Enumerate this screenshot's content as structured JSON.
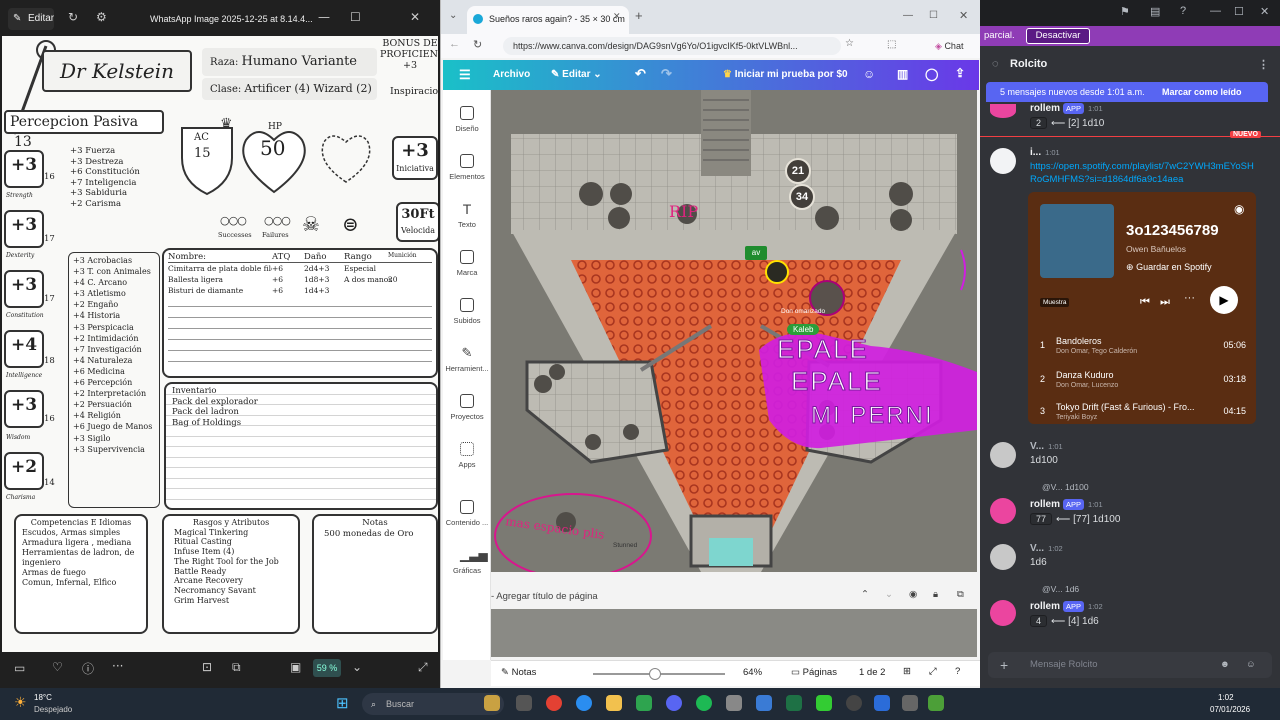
{
  "viewer": {
    "edit_label": "Editar",
    "title": "WhatsApp Image 2025-12-25 at 8.14.4...",
    "zoom": "59 %"
  },
  "sheet": {
    "name": "Dr Kelstein",
    "raza_label": "Raza:",
    "raza": "Humano Variante",
    "clase_label": "Clase:",
    "clase": "Artificer (4) Wizard (2)",
    "bonus": "BONUS DE PROFICIENCY",
    "bonus_val": "+3",
    "inspiracion": "Inspiracion",
    "percepcion": "Percepcion Pasiva",
    "percepcion_val": "13",
    "ac_label": "AC",
    "ac": "15",
    "hp_label": "HP",
    "hp": "50",
    "iniciativa": "Iniciativa",
    "iniciativa_val": "+3",
    "velocidad": "Velocida",
    "velocidad_val": "30Ft",
    "successes": "Successes",
    "failures": "Failures",
    "abilities": [
      {
        "mod": "+3",
        "score": "16",
        "name": "Strength"
      },
      {
        "mod": "+3",
        "score": "17",
        "name": "Dexterity"
      },
      {
        "mod": "+3",
        "score": "17",
        "name": "Constitution"
      },
      {
        "mod": "+4",
        "score": "18",
        "name": "Intelligence"
      },
      {
        "mod": "+3",
        "score": "16",
        "name": "Wisdom"
      },
      {
        "mod": "+2",
        "score": "14",
        "name": "Charisma"
      }
    ],
    "saves": [
      {
        "v": "+3",
        "n": "Fuerza"
      },
      {
        "v": "+3",
        "n": "Destreza"
      },
      {
        "v": "+6",
        "n": "Constitución"
      },
      {
        "v": "+7",
        "n": "Inteligencia"
      },
      {
        "v": "+3",
        "n": "Sabiduria"
      },
      {
        "v": "+2",
        "n": "Carisma"
      }
    ],
    "skills": [
      {
        "v": "+3",
        "n": "Acrobacias"
      },
      {
        "v": "+3",
        "n": "T. con Animales"
      },
      {
        "v": "+4",
        "n": "C. Arcano"
      },
      {
        "v": "+3",
        "n": "Atletismo"
      },
      {
        "v": "+2",
        "n": "Engaño"
      },
      {
        "v": "+4",
        "n": "Historia"
      },
      {
        "v": "+3",
        "n": "Perspicacia"
      },
      {
        "v": "+2",
        "n": "Intimidación"
      },
      {
        "v": "+7",
        "n": "Investigación"
      },
      {
        "v": "+4",
        "n": "Naturaleza"
      },
      {
        "v": "+6",
        "n": "Medicina"
      },
      {
        "v": "+6",
        "n": "Percepción"
      },
      {
        "v": "+2",
        "n": "Interpretación"
      },
      {
        "v": "+2",
        "n": "Persuación"
      },
      {
        "v": "+4",
        "n": "Religión"
      },
      {
        "v": "+6",
        "n": "Juego de Manos"
      },
      {
        "v": "+3",
        "n": "Sigilo"
      },
      {
        "v": "+3",
        "n": "Supervivencia"
      }
    ],
    "attack_headers": [
      "Nombre:",
      "ATQ",
      "Daño",
      "Rango",
      "Munición"
    ],
    "attacks": [
      {
        "n": "Cimitarra de plata doble filo",
        "a": "+6",
        "d": "2d4+3",
        "r": "Especial",
        "m": ""
      },
      {
        "n": "Ballesta ligera",
        "a": "+6",
        "d": "1d8+3",
        "r": "A dos manos",
        "m": "20"
      },
      {
        "n": "Bisturi de diamante",
        "a": "+6",
        "d": "1d4+3",
        "r": "",
        "m": ""
      }
    ],
    "inventario_title": "Inventario",
    "inventario": [
      "Pack del explorador",
      "Pack del ladron",
      "Bag of Holdings"
    ],
    "competencias_title": "Competencias E Idiomas",
    "competencias": [
      "Escudos, Armas simples",
      "Armadura ligera , mediana",
      "Herramientas de ladron, de ingeniero",
      "Armas de fuego",
      "Comun, Infernal, Elfico"
    ],
    "rasgos_title": "Rasgos y Atributos",
    "rasgos": [
      "Magical Tinkering",
      "Ritual Casting",
      "Infuse Item (4)",
      "The Right Tool for the Job",
      "Battle Ready",
      "Arcane Recovery",
      "Necromancy Savant",
      "Grim Harvest"
    ],
    "notas_title": "Notas",
    "notas": [
      "500 monedas de Oro"
    ]
  },
  "browser": {
    "tab_title": "Sueños raros again? - 35 × 30 cm",
    "url": "https://www.canva.com/design/DAG9snVg6Yo/O1igvcIKf5-0ktVLWBnl...",
    "chat": "Chat",
    "canva": {
      "archivo": "Archivo",
      "editar": "Editar",
      "trial": "Iniciar mi prueba por $0",
      "side": [
        "Diseño",
        "Elementos",
        "Texto",
        "Marca",
        "Subidos",
        "Herramient...",
        "Proyectos",
        "Apps",
        "Contenido ...",
        "Gráficas"
      ],
      "page_title_placeholder": "- Agregar título de página",
      "notas": "Notas",
      "zoom": "64%",
      "paginas": "Páginas",
      "page_count": "1 de 2"
    },
    "map": {
      "token_21": "21",
      "token_34": "34",
      "av": "av",
      "don_label": "Don omarizado",
      "kaleb": "Kaleb",
      "rip": "RIP",
      "scribble_1": "EPALE",
      "scribble_2": "EPALE",
      "scribble_3": "MI PERNI",
      "pink_note": "mas espacio plis",
      "stunned": "Stunned"
    }
  },
  "discord": {
    "banner_text": "parcial.",
    "banner_button": "Desactivar",
    "channel": "Rolcito",
    "new_messages": "5 mensajes nuevos desde 1:01 a.m.",
    "mark_read": "Marcar como leído",
    "nuevo": "NUEVO",
    "messages": [
      {
        "name": "rollem",
        "app": "APP",
        "time": "1:01",
        "roll": "2",
        "text": "⟵ [2] 1d10"
      },
      {
        "name": "i...",
        "time": "1:01",
        "link": "https://open.spotify.com/playlist/7wC2YWH3mEYoSHRoGMHFMS?si=d1864df6a9c14aea"
      },
      {
        "name": "V...",
        "time": "1:01",
        "text": "1d100"
      },
      {
        "reply": "@V... 1d100",
        "name": "rollem",
        "app": "APP",
        "time": "1:01",
        "roll": "77",
        "text": "⟵ [77] 1d100"
      },
      {
        "name": "V...",
        "time": "1:02",
        "text": "1d6"
      },
      {
        "reply": "@V... 1d6",
        "name": "rollem",
        "app": "APP",
        "time": "1:02",
        "roll": "4",
        "text": "⟵ [4] 1d6"
      }
    ],
    "spotify": {
      "title": "3o123456789",
      "owner": "Owen Bañuelos",
      "save": "Guardar en Spotify",
      "sample": "Muestra",
      "tracks": [
        {
          "num": "1",
          "title": "Bandoleros",
          "artist": "Don Omar, Tego Calderón",
          "dur": "05:06"
        },
        {
          "num": "2",
          "title": "Danza Kuduro",
          "artist": "Don Omar, Lucenzo",
          "dur": "03:18"
        },
        {
          "num": "3",
          "title": "Tokyo Drift (Fast & Furious) - Fro...",
          "artist": "Teriyaki Boyz",
          "dur": "04:15"
        }
      ]
    },
    "input_placeholder": "Mensaje Rolcito"
  },
  "taskbar": {
    "temp": "18°C",
    "weather": "Despejado",
    "search": "Buscar",
    "time": "1:02",
    "date": "07/01/2026"
  }
}
